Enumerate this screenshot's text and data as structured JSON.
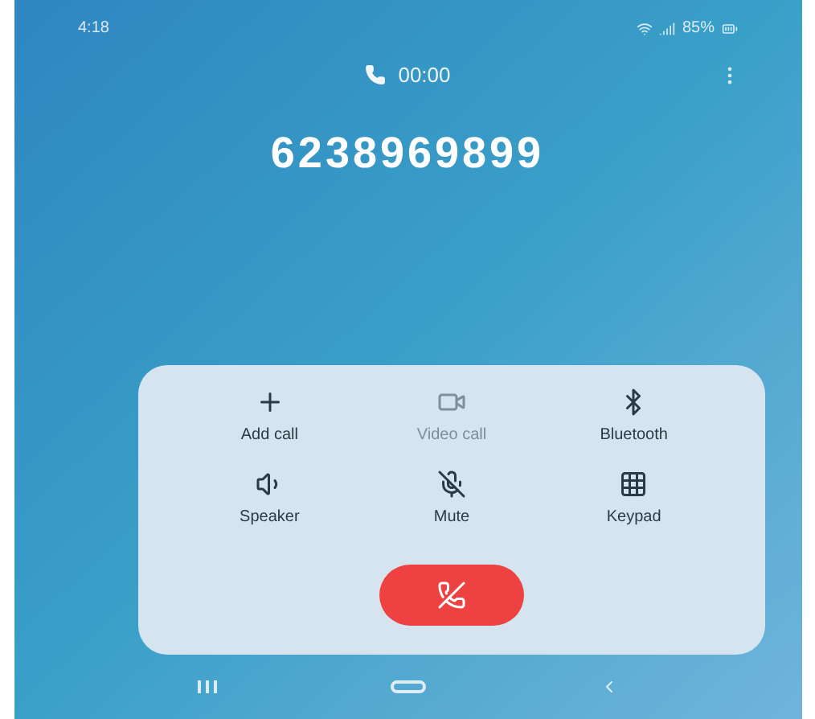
{
  "status_bar": {
    "time": "4:18",
    "battery": "85%"
  },
  "call": {
    "timer": "00:00",
    "number": "6238969899"
  },
  "actions": [
    {
      "kind": "add",
      "label": "Add call",
      "disabled": false
    },
    {
      "kind": "video",
      "label": "Video call",
      "disabled": true
    },
    {
      "kind": "bluetooth",
      "label": "Bluetooth",
      "disabled": false
    },
    {
      "kind": "speaker",
      "label": "Speaker",
      "disabled": false
    },
    {
      "kind": "mute",
      "label": "Mute",
      "disabled": false
    },
    {
      "kind": "keypad",
      "label": "Keypad",
      "disabled": false
    }
  ]
}
